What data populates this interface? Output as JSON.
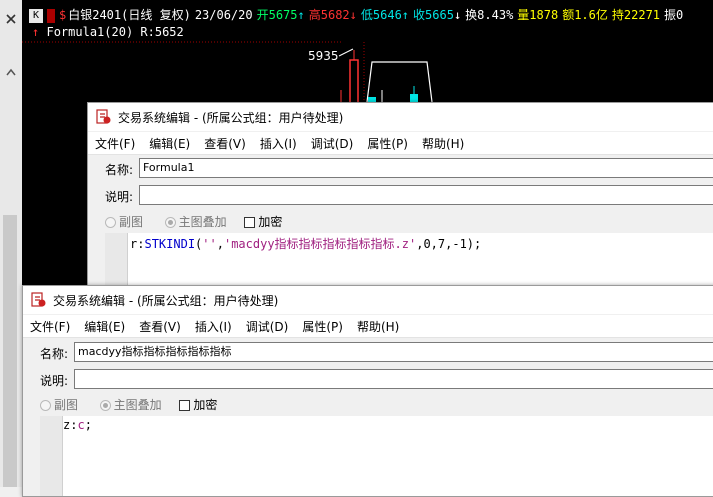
{
  "chart": {
    "k_button": "K",
    "dollar_icon": "$",
    "stock_name": "白银2401(日线 复权)",
    "date": "23/06/20",
    "open": "开5675",
    "open_arrow": "↑",
    "high": "高5682",
    "high_arrow": "↓",
    "low": "低5646",
    "low_arrow": "↑",
    "close": "收5665",
    "close_arrow": "↓",
    "turnover": "换8.43%",
    "volume": "量1878",
    "amount": "额1.6亿",
    "hold": "持22271",
    "amplitude": "振0",
    "formula_arrow": "↑",
    "formula_line": "Formula1(20) R:5652",
    "price_label": "5935",
    "colors": {
      "up": "#ff3232",
      "down": "#00e5e5",
      "neutral": "#ffffff",
      "yellow": "#ffff00",
      "green": "#00ff66"
    }
  },
  "dialog_back": {
    "title": "交易系统编辑 - (所属公式组：用户待处理)",
    "menu": [
      "文件(F)",
      "编辑(E)",
      "查看(V)",
      "插入(I)",
      "调试(D)",
      "属性(P)",
      "帮助(H)"
    ],
    "name_label": "名称:",
    "name_value": "Formula1",
    "desc_label": "说明:",
    "desc_value": "",
    "opt_sub": "副图",
    "opt_main": "主图叠加",
    "opt_encrypt": "加密",
    "code": {
      "var": "r",
      "colon": ":",
      "func": "STKINDI",
      "open_paren": "(",
      "arg1": "''",
      "comma": ",",
      "arg2": "'macdyy指标指标指标指标指标.z'",
      "rest": ",0,7,-1);"
    }
  },
  "dialog_front": {
    "title": "交易系统编辑 - (所属公式组：用户待处理)",
    "menu": [
      "文件(F)",
      "编辑(E)",
      "查看(V)",
      "插入(I)",
      "调试(D)",
      "属性(P)",
      "帮助(H)"
    ],
    "name_label": "名称:",
    "name_value": "macdyy指标指标指标指标指标",
    "desc_label": "说明:",
    "desc_value": "",
    "opt_sub": "副图",
    "opt_main": "主图叠加",
    "opt_encrypt": "加密",
    "code": {
      "var": "z",
      "colon": ":",
      "value": "c",
      "semi": ";"
    }
  }
}
